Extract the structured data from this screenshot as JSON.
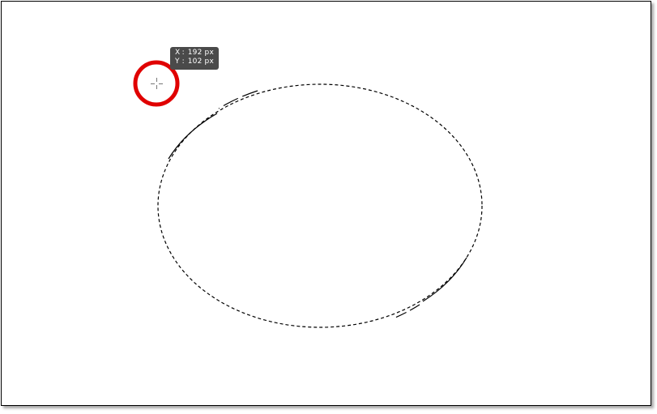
{
  "canvas": {
    "background": "#ffffff",
    "border_color": "#000000"
  },
  "selection": {
    "tool": "elliptical-marquee",
    "stroke_color": "#000000"
  },
  "cursor": {
    "icon": "crosshair-icon",
    "highlight_icon": "highlight-ring-icon",
    "highlight_color": "#e00000",
    "crosshair_color": "#777777"
  },
  "tooltip": {
    "x_axis": "X",
    "y_axis": "Y",
    "separator": ":",
    "x_value": "192 px",
    "y_value": "102 px",
    "background": "#4a4a4a",
    "text_color": "#ffffff"
  }
}
